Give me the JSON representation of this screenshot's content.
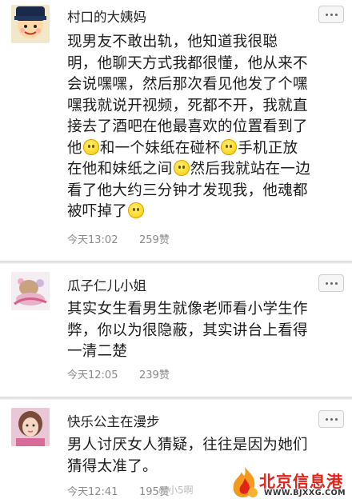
{
  "comments": [
    {
      "username": "村口的大姨妈",
      "lines": [
        [
          "现男友不敢出轨，他知道我很聪"
        ],
        [
          "明，他聊天方式我都很懂，他从来不"
        ],
        [
          "会说嘿嘿，然后那次看见他发了个嘿"
        ],
        [
          "嘿我就说开视频，死都不开，我就直"
        ],
        [
          "接去了酒吧在他最喜欢的位置看到了"
        ],
        [
          "他",
          "和一个妹纸在碰杯",
          "手机正放"
        ],
        [
          "在他和妹纸之间",
          "然后我就站在一边"
        ],
        [
          "看了他大约三分钟才发现我，他魂都"
        ],
        [
          "被吓掉了"
        ]
      ],
      "time": "今天13:02",
      "likes": "259赞"
    },
    {
      "username": "瓜子仁儿小姐",
      "lines": [
        [
          "其实女生看男生就像老师看小学生作"
        ],
        [
          "弊，你以为很隐蔽，其实讲台上看得"
        ],
        [
          "一清二楚"
        ]
      ],
      "time": "今天12:05",
      "likes": "239赞"
    },
    {
      "username": "快乐公主在漫步",
      "lines": [
        [
          "男人讨厌女人猜疑，往往是因为她们"
        ],
        [
          "猜得太准了。"
        ]
      ],
      "time": "今天12:41",
      "likes": "195赞"
    }
  ],
  "watermark": {
    "credit": "@小5啊",
    "site_name": "北京信息港",
    "site_url": "WWW.BJXXG.COM"
  },
  "icons": {
    "more": "more-dots-icon",
    "emoji": "smile-emoji-icon",
    "logo": "flame-logo-icon"
  },
  "colors": {
    "text": "#1c1c1c",
    "meta": "#8a8a8a",
    "divider": "#e6e6e6",
    "logo_red": "#e2231a"
  }
}
